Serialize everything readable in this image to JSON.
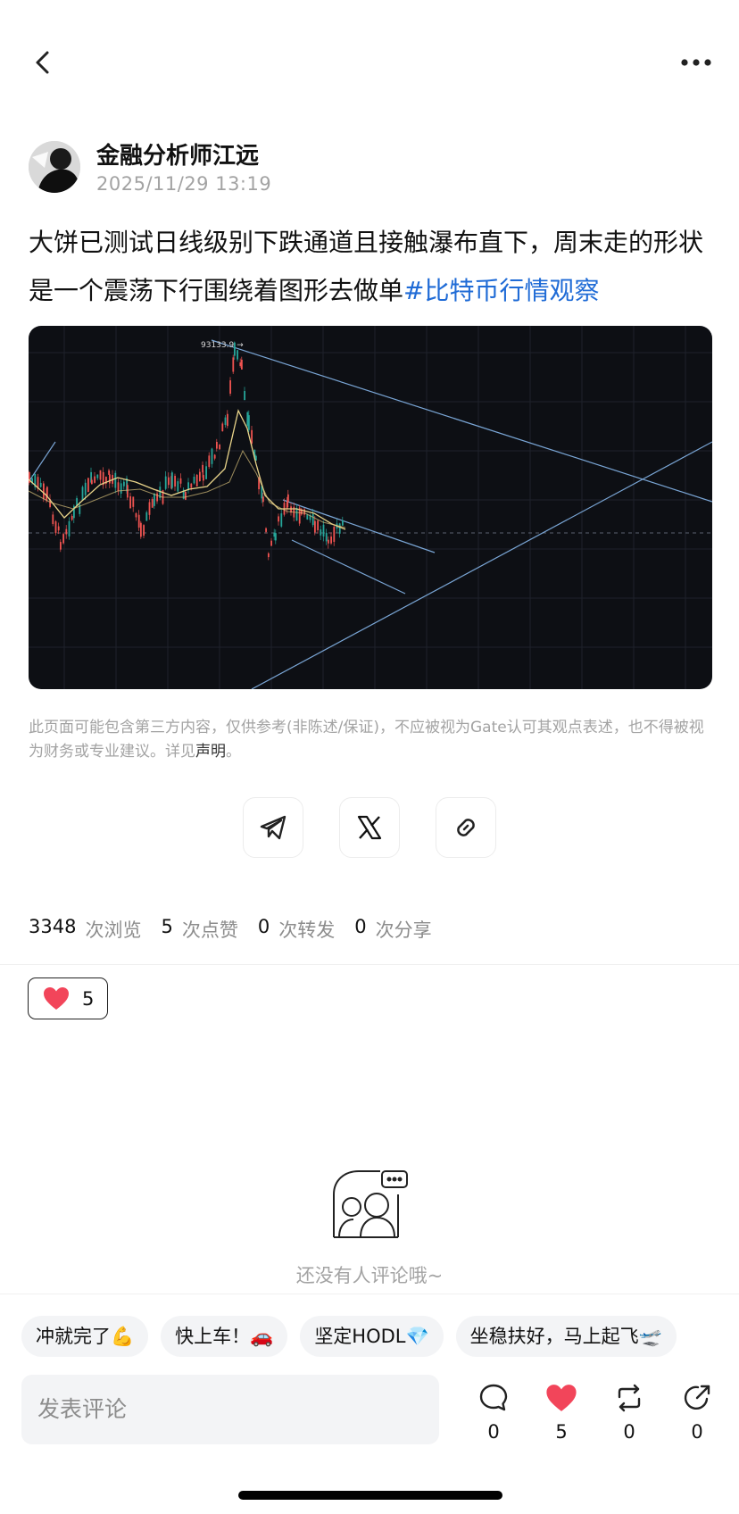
{
  "nav": {
    "back_icon": "chevron-left-icon",
    "more_icon": "more-horizontal-icon"
  },
  "post": {
    "author": "金融分析师江远",
    "time": "2025/11/29 13:19",
    "text": "大饼已测试日线级别下跌通道且接触瀑布直下，周末走的形状是一个震荡下行围绕着图形去做单",
    "hashtag": "#比特币行情观察"
  },
  "chart": {
    "peak_label": "93133.9 →"
  },
  "disclaimer": {
    "text": "此页面可能包含第三方内容，仅供参考(非陈述/保证)，不应被视为Gate认可其观点表述，也不得被视为财务或专业建议。详见",
    "link": "声明",
    "end": "。"
  },
  "share": [
    {
      "name": "telegram-icon"
    },
    {
      "name": "x-icon"
    },
    {
      "name": "link-icon"
    }
  ],
  "stats": {
    "views": "3348",
    "views_label": "次浏览",
    "likes": "5",
    "likes_label": "次点赞",
    "reposts": "0",
    "reposts_label": "次转发",
    "shares": "0",
    "shares_label": "次分享"
  },
  "reaction": {
    "icon": "heart-icon",
    "count": "5"
  },
  "empty": {
    "text": "还没有人评论哦~"
  },
  "chips": [
    "冲就完了💪",
    "快上车！🚗",
    "坚定HODL💎",
    "坐稳扶好，马上起飞🛫"
  ],
  "comment": {
    "placeholder": "发表评论"
  },
  "actions": {
    "comments": "0",
    "likes": "5",
    "reposts": "0",
    "shares": "0"
  },
  "colors": {
    "accent": "#1f6bd6",
    "heart": "#f2455a",
    "chart_bg": "#0d0f14"
  }
}
